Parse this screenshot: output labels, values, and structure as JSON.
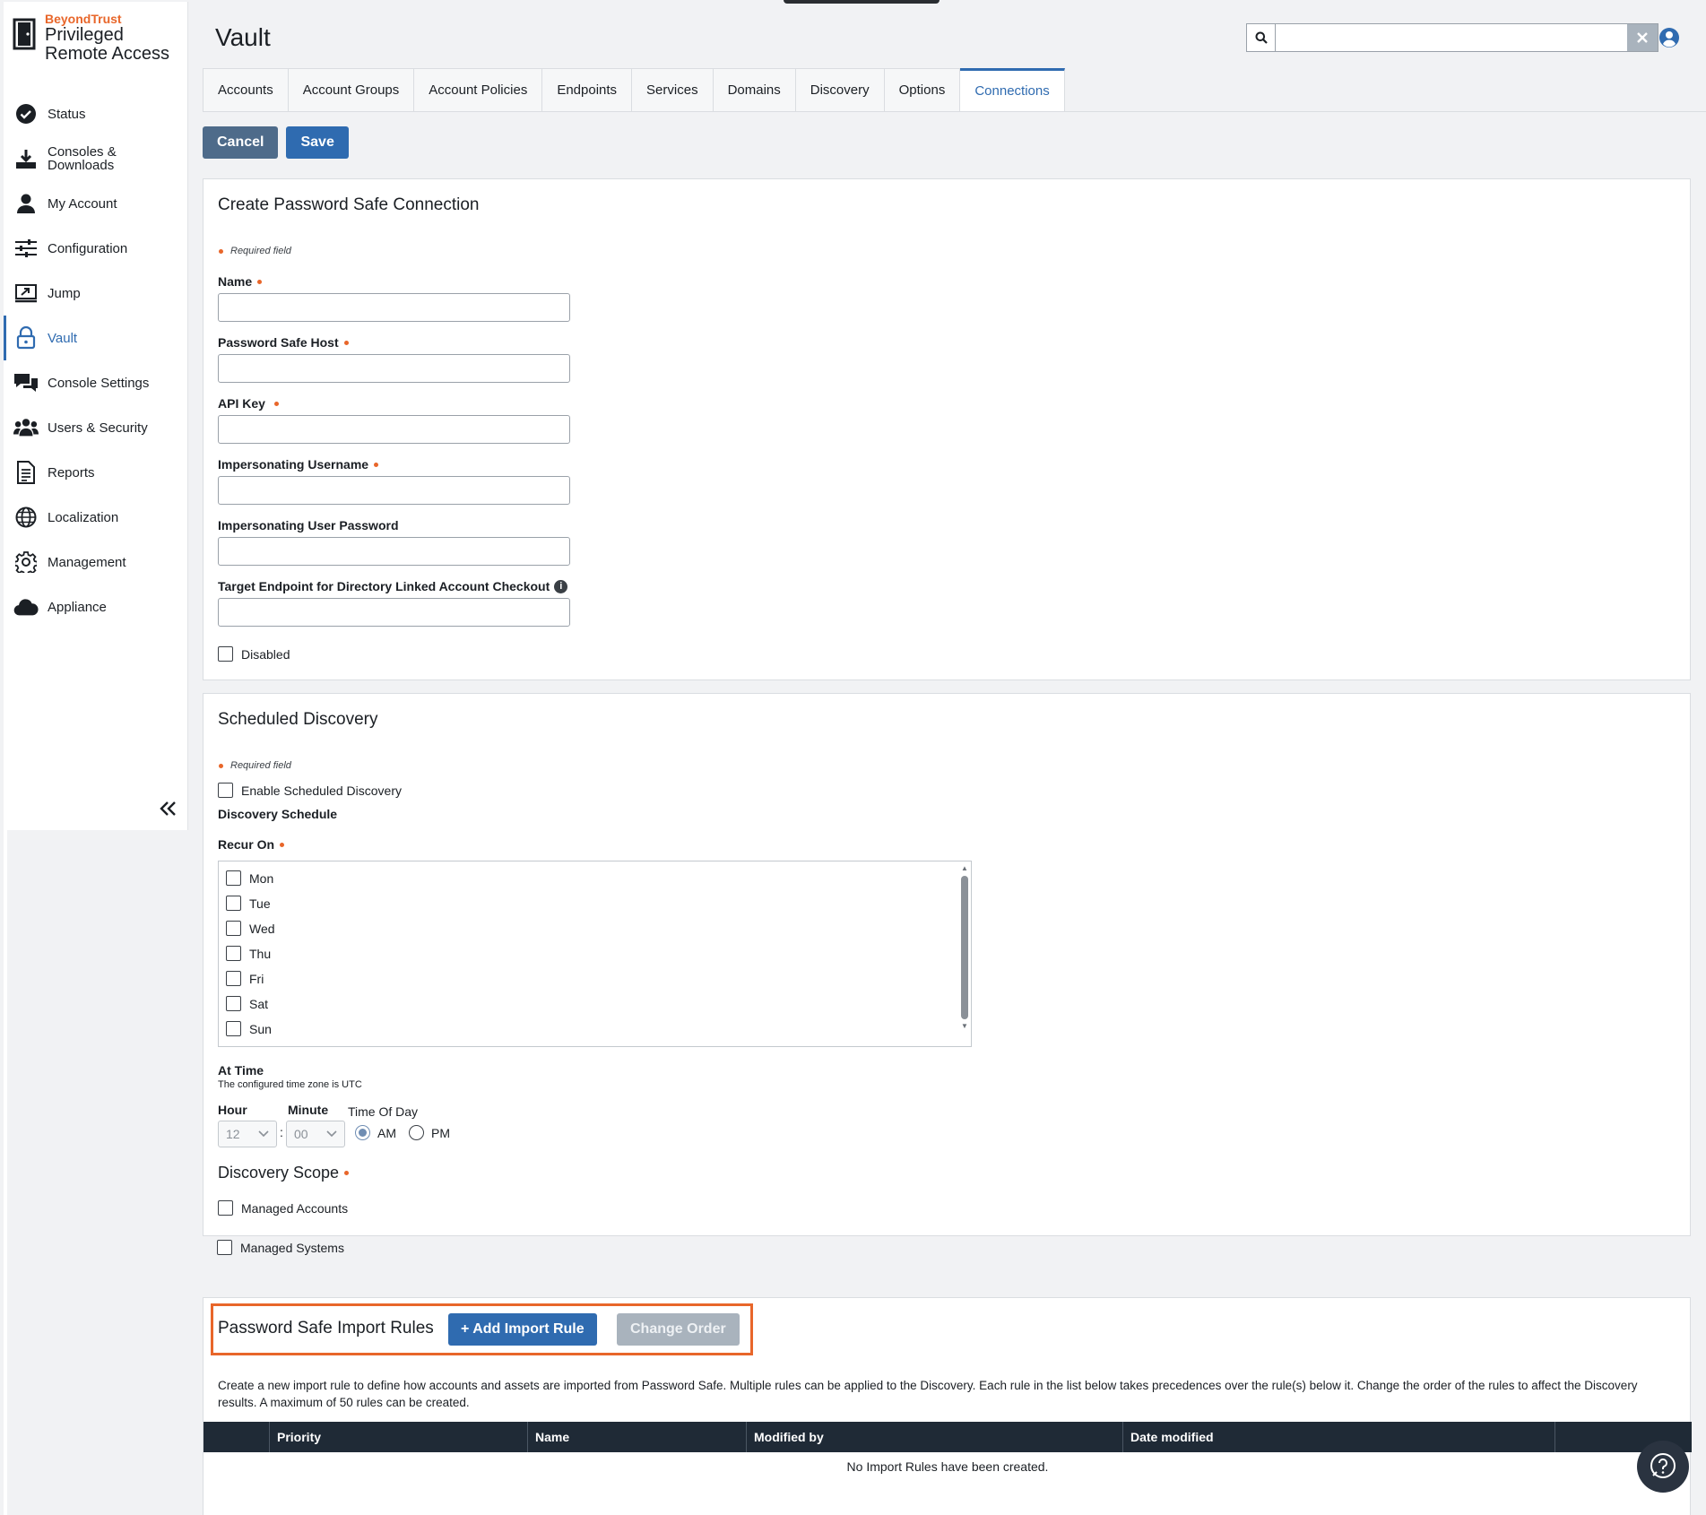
{
  "brand": {
    "company": "BeyondTrust",
    "product_line1": "Privileged",
    "product_line2": "Remote Access"
  },
  "sidebar": {
    "items": [
      {
        "label": "Status",
        "icon": "status-check-icon"
      },
      {
        "label": "Consoles & Downloads",
        "icon": "download-icon"
      },
      {
        "label": "My Account",
        "icon": "user-icon"
      },
      {
        "label": "Configuration",
        "icon": "sliders-icon"
      },
      {
        "label": "Jump",
        "icon": "jump-icon"
      },
      {
        "label": "Vault",
        "icon": "lock-icon",
        "active": true
      },
      {
        "label": "Console Settings",
        "icon": "chat-icon"
      },
      {
        "label": "Users & Security",
        "icon": "users-icon"
      },
      {
        "label": "Reports",
        "icon": "report-icon"
      },
      {
        "label": "Localization",
        "icon": "globe-icon"
      },
      {
        "label": "Management",
        "icon": "gear-icon"
      },
      {
        "label": "Appliance",
        "icon": "cloud-icon"
      }
    ]
  },
  "header": {
    "title": "Vault",
    "search": {
      "value": "",
      "placeholder": ""
    }
  },
  "tabs": [
    {
      "label": "Accounts"
    },
    {
      "label": "Account Groups"
    },
    {
      "label": "Account Policies"
    },
    {
      "label": "Endpoints"
    },
    {
      "label": "Services"
    },
    {
      "label": "Domains"
    },
    {
      "label": "Discovery"
    },
    {
      "label": "Options"
    },
    {
      "label": "Connections",
      "active": true
    }
  ],
  "actions": {
    "cancel_label": "Cancel",
    "save_label": "Save"
  },
  "connection_form": {
    "title": "Create Password Safe Connection",
    "required_note": "Required field",
    "fields": {
      "name": {
        "label": "Name",
        "value": ""
      },
      "host": {
        "label": "Password Safe Host",
        "value": ""
      },
      "api_key": {
        "label": "API Key",
        "value": ""
      },
      "imp_user": {
        "label": "Impersonating Username",
        "value": ""
      },
      "imp_pass": {
        "label": "Impersonating User Password",
        "value": ""
      },
      "target_endpoint": {
        "label": "Target Endpoint for Directory Linked Account Checkout",
        "value": ""
      }
    },
    "disabled_label": "Disabled",
    "info_glyph": "i"
  },
  "discovery": {
    "title": "Scheduled Discovery",
    "required_note": "Required field",
    "enable_label": "Enable Scheduled Discovery",
    "schedule_label": "Discovery Schedule",
    "recur_label": "Recur On",
    "days": [
      "Mon",
      "Tue",
      "Wed",
      "Thu",
      "Fri",
      "Sat",
      "Sun"
    ],
    "at_time_label": "At Time",
    "timezone_note": "The configured time zone is UTC",
    "hour_label": "Hour",
    "minute_label": "Minute",
    "tod_label": "Time Of Day",
    "hour_value": "12",
    "minute_value": "00",
    "colon": ":",
    "am_label": "AM",
    "pm_label": "PM",
    "selected_tod": "AM",
    "scope_label": "Discovery Scope",
    "scope_options": [
      "Managed Accounts",
      "Managed Systems"
    ]
  },
  "import_rules": {
    "title": "Password Safe Import Rules",
    "add_label": "Add Import Rule",
    "add_glyph": "+",
    "change_order_label": "Change Order",
    "description": "Create a new import rule to define how accounts and assets are imported from Password Safe. Multiple rules can be applied to the Discovery. Each rule in the list below takes precedences over the rule(s) below it. Change the order of the rules to affect the Discovery results. A maximum of 50 rules can be created.",
    "columns": [
      "",
      "Priority",
      "Name",
      "Modified by",
      "Date modified",
      ""
    ],
    "empty_message": "No Import Rules have been created."
  },
  "colors": {
    "accent": "#2f6bb0",
    "brand_orange": "#e8662a",
    "table_header": "#1f2a36"
  }
}
